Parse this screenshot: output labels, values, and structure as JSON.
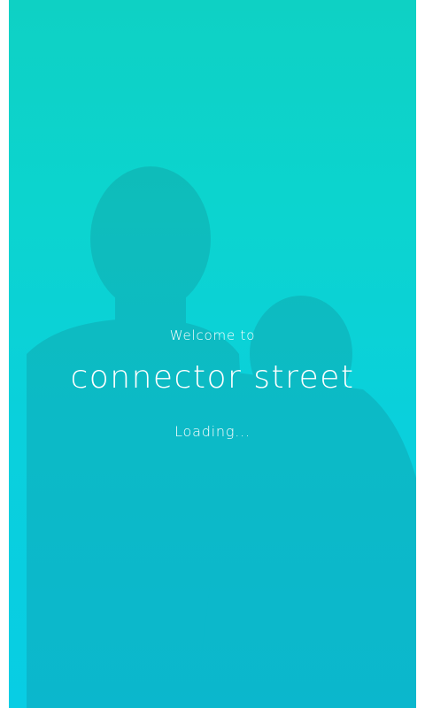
{
  "splash": {
    "welcome_text": "Welcome to",
    "brand_name": "connector street",
    "loading_text": "Loading...",
    "gradient_colors": [
      "#0ed1c4",
      "#08cde4"
    ],
    "text_color": "#ffffff"
  }
}
